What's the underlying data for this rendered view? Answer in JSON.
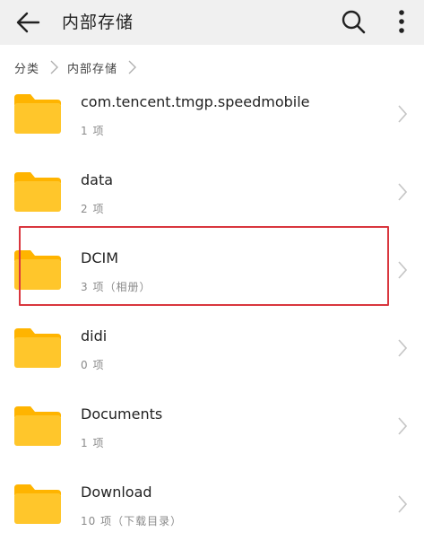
{
  "appbar": {
    "title": "内部存储"
  },
  "breadcrumb": {
    "items": [
      "分类",
      "内部存储"
    ]
  },
  "folders": [
    {
      "name": "com.tencent.tmgp.speedmobile",
      "meta": "1 项"
    },
    {
      "name": "data",
      "meta": "2 项"
    },
    {
      "name": "DCIM",
      "meta": "3 项（相册）"
    },
    {
      "name": "didi",
      "meta": "0 项"
    },
    {
      "name": "Documents",
      "meta": "1 项"
    },
    {
      "name": "Download",
      "meta": "10 项（下载目录）"
    }
  ],
  "colors": {
    "folder": "#ffc62b",
    "folder_tab": "#ffb400",
    "highlight": "#d9363e",
    "appbar": "#f0f0f0"
  }
}
